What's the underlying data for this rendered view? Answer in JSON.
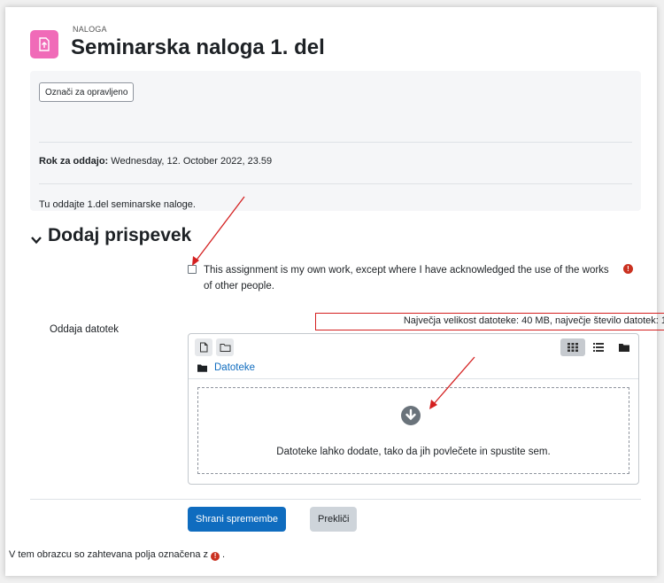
{
  "module": {
    "type_label": "NALOGA",
    "title": "Seminarska naloga 1. del",
    "icon": "assignment-upload-icon",
    "icon_color": "#f06bb8"
  },
  "activity": {
    "mark_done_label": "Označi za opravljeno",
    "due_label": "Rok za oddajo:",
    "due_value": " Wednesday, 12. October 2022, 23.59",
    "intro": "Tu oddajte 1.del seminarske naloge."
  },
  "submission": {
    "section_title": "Dodaj prispevek",
    "statement": "This assignment is my own work, except where I have acknowledged the use of the works of other people.",
    "statement_checked": false,
    "file_field_label": "Oddaja datotek",
    "max_size_text": "Največja velikost datoteke: 40 MB, največje število datotek: 1",
    "folder_name": "Datoteke",
    "dropzone_text": "Datoteke lahko dodate, tako da jih povlečete in spustite sem.",
    "toolbar_icons": [
      "add-file-icon",
      "create-folder-icon"
    ],
    "view_modes": [
      "icons-view-icon",
      "list-view-icon",
      "tree-view-icon"
    ],
    "active_view": "icons-view-icon"
  },
  "actions": {
    "save_label": "Shrani spremembe",
    "cancel_label": "Prekliči"
  },
  "footer": {
    "required_note_before": "V tem obrazcu so zahtevana polja označena z",
    "required_note_after": "."
  },
  "colors": {
    "primary": "#0f6cbf",
    "required": "#ca3120",
    "annotation": "#d42020"
  }
}
